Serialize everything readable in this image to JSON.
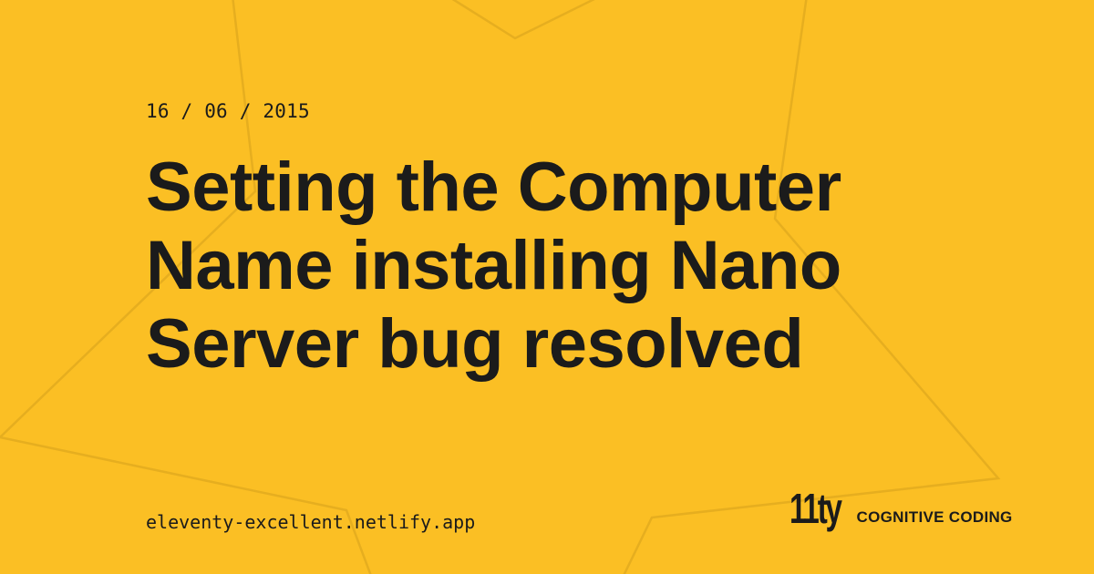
{
  "post": {
    "date": "16 / 06 / 2015",
    "title": "Setting the Computer Name installing Nano Server bug resolved"
  },
  "footer": {
    "url": "eleventy-excellent.netlify.app",
    "logo_text": "11ty",
    "site_name": "COGNITIVE CODING"
  },
  "colors": {
    "background": "#fbbf24",
    "text": "#1b1b1b",
    "decorative_lines": "#e0a91f"
  },
  "icons": {
    "background": "star-outline-shape",
    "logo": "eleventy-logo"
  }
}
